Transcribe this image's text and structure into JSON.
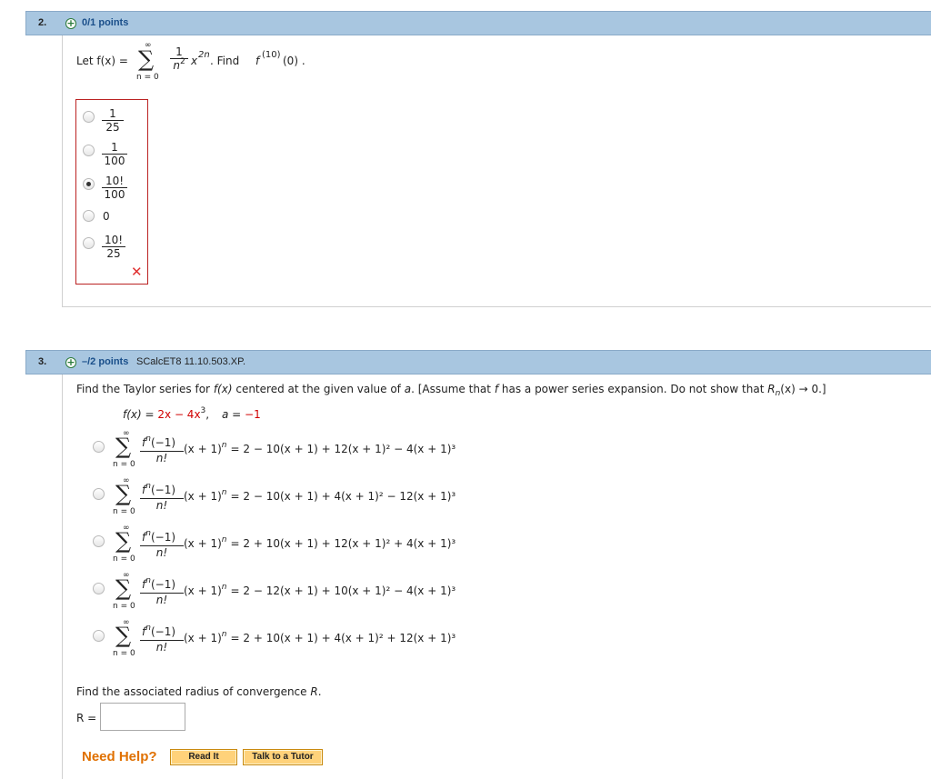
{
  "q2": {
    "number": "2.",
    "plus": "+",
    "points": "0/1 points",
    "let": "Let f(x) =",
    "sum_top": "∞",
    "sigma": "∑",
    "sum_bot": "n = 0",
    "coef_num": "1",
    "coef_den": "n",
    "coef_den_exp": "2",
    "x_base": "x",
    "x_exp": "2n",
    "find_prefix": ". Find",
    "find_f": "f",
    "find_exp": "(10)",
    "find_arg": "(0) .",
    "options": [
      {
        "num": "1",
        "den": "25",
        "selected": false
      },
      {
        "num": "1",
        "den": "100",
        "selected": false
      },
      {
        "num": "10!",
        "den": "100",
        "selected": true
      },
      {
        "text": "0",
        "selected": false
      },
      {
        "num": "10!",
        "den": "25",
        "selected": false
      }
    ],
    "wrong_mark": "✕"
  },
  "q3": {
    "number": "3.",
    "plus": "+",
    "points": "–/2 points",
    "source": "SCalcET8 11.10.503.XP.",
    "prompt_a": "Find the Taylor series for",
    "prompt_fx": "f(x)",
    "prompt_b": "centered at the given value of",
    "prompt_a_var": "a",
    "prompt_c": ". [Assume that",
    "prompt_f": "f",
    "prompt_d": "has a power series expansion. Do not show that",
    "prompt_R": "R",
    "prompt_n": "n",
    "prompt_e": "(x) → 0.]",
    "given_f": "f(x) =",
    "given_expr_1": "2x − 4x",
    "given_expr_exp": "3",
    "given_comma": ",",
    "given_a": "a",
    "given_eq": "=",
    "given_a_val": "−1",
    "options": [
      {
        "rhs": "= 2 − 10(x + 1) + 12(x + 1)² − 4(x + 1)³"
      },
      {
        "rhs": "= 2 − 10(x + 1) + 4(x + 1)² − 12(x + 1)³"
      },
      {
        "rhs": "= 2 + 10(x + 1) + 12(x + 1)² + 4(x + 1)³"
      },
      {
        "rhs": "= 2 − 12(x + 1) + 10(x + 1)² − 4(x + 1)³"
      },
      {
        "rhs": "= 2 + 10(x + 1) + 4(x + 1)² + 12(x + 1)³"
      }
    ],
    "sum_top": "∞",
    "sigma": "∑",
    "sum_bot": "n = 0",
    "term_num": "f",
    "term_num_exp": "n",
    "term_num_arg": "(−1)",
    "term_den": "n!",
    "term_tail": "(x + 1)",
    "term_tail_exp": "n",
    "radius_prompt": "Find the associated radius of convergence",
    "radius_R": "R",
    "radius_dot": ".",
    "r_label": "R =",
    "r_value": "",
    "need_help": "Need Help?",
    "read_it": "Read It",
    "talk_tutor": "Talk to a Tutor"
  }
}
